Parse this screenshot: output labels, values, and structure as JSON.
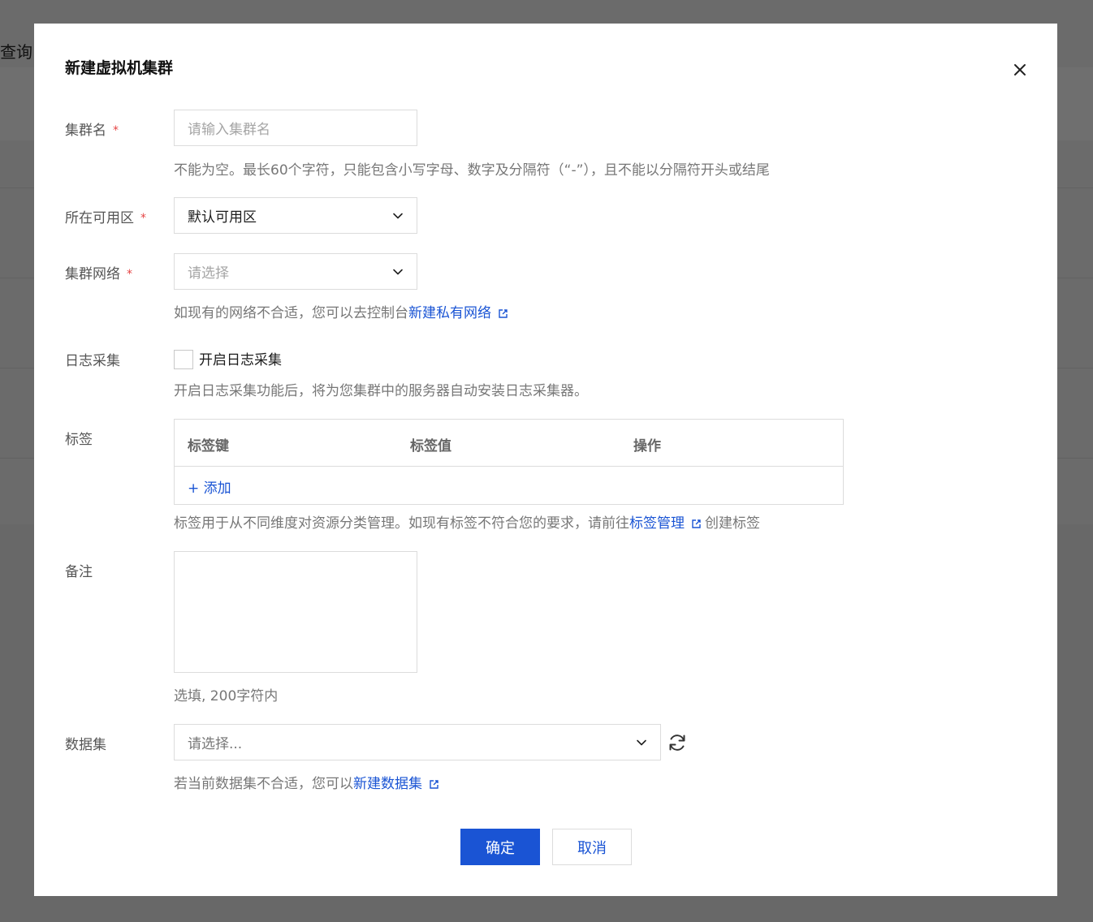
{
  "background": {
    "query_label": "查询"
  },
  "modal": {
    "title": "新建虚拟机集群",
    "fields": {
      "cluster_name": {
        "label": "集群名",
        "required_mark": "*",
        "placeholder": "请输入集群名",
        "help": "不能为空。最长60个字符，只能包含小写字母、数字及分隔符（“-”），且不能以分隔符开头或结尾"
      },
      "zone": {
        "label": "所在可用区",
        "required_mark": "*",
        "value": "默认可用区"
      },
      "network": {
        "label": "集群网络",
        "required_mark": "*",
        "placeholder": "请选择",
        "help_prefix": "如现有的网络不合适，您可以去控制台",
        "help_link": "新建私有网络"
      },
      "log": {
        "label": "日志采集",
        "checkbox_label": "开启日志采集",
        "checked": false,
        "help": "开启日志采集功能后，将为您集群中的服务器自动安装日志采集器。"
      },
      "tags": {
        "label": "标签",
        "columns": [
          "标签键",
          "标签值",
          "操作"
        ],
        "add_label": "+ 添加",
        "help_prefix": "标签用于从不同维度对资源分类管理。如现有标签不符合您的要求，请前往",
        "help_link": "标签管理",
        "help_suffix": "创建标签"
      },
      "remark": {
        "label": "备注",
        "value": "",
        "help": "选填, 200字符内"
      },
      "dataset": {
        "label": "数据集",
        "placeholder": "请选择...",
        "help_prefix": "若当前数据集不合适，您可以",
        "help_link": "新建数据集"
      }
    },
    "buttons": {
      "confirm": "确定",
      "cancel": "取消"
    }
  },
  "icons": {
    "close": "close-icon",
    "chevron": "chevron-down-icon",
    "external_link": "external-link-icon",
    "refresh": "refresh-icon"
  },
  "colors": {
    "primary": "#1a54d4",
    "required": "#e54545",
    "overlay": "#6b6b6b"
  }
}
